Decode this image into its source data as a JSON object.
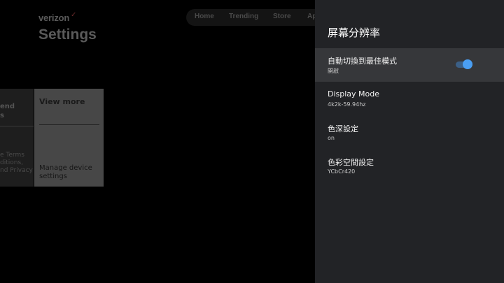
{
  "background": {
    "brand": "verizon",
    "brand_mark": "✓",
    "title": "Settings",
    "nav": [
      "Home",
      "Trending",
      "Store",
      "Ap"
    ],
    "left_card": {
      "title_line1": "end",
      "title_line2": "s",
      "sub_line1": "e Terms",
      "sub_line2": "ditions,",
      "sub_line3": "nd Privacy"
    },
    "main_card": {
      "title": "View more",
      "sub_line1": "Manage device",
      "sub_line2": "settings"
    }
  },
  "panel": {
    "title": "屏幕分辨率",
    "rows": [
      {
        "label": "自動切換到最佳模式",
        "value": "開啟",
        "toggle_on": true
      },
      {
        "label": "Display Mode",
        "value": "4k2k-59.94hz"
      },
      {
        "label": "色深設定",
        "value": "on"
      },
      {
        "label": "色彩空間設定",
        "value": "YCbCr420"
      }
    ]
  },
  "colors": {
    "panel_bg": "#222326",
    "active_row": "#36373a",
    "toggle_accent": "#4a9ef2"
  }
}
